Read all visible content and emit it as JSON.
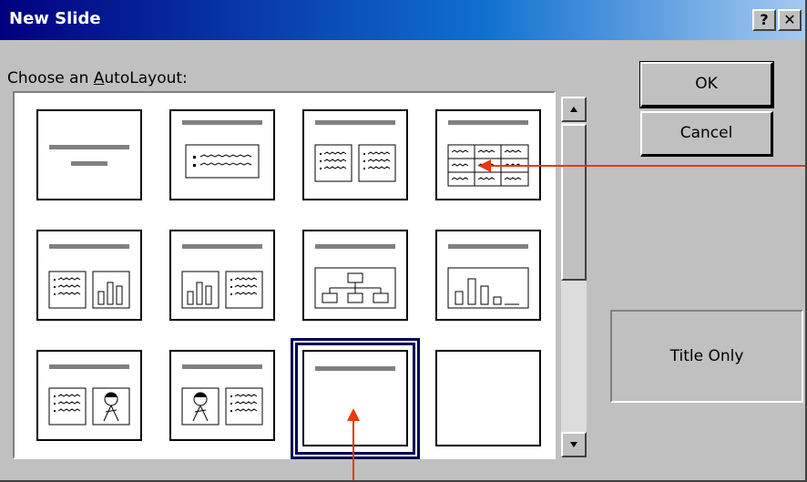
{
  "window": {
    "title": "New Slide",
    "help_label": "?",
    "close_label": "✕"
  },
  "gallery": {
    "label_prefix": "Choose an ",
    "label_accel": "A",
    "label_suffix": "utoLayout:",
    "layouts": [
      {
        "name": "Title Slide",
        "icon": "title-slide-layout"
      },
      {
        "name": "Bulleted List",
        "icon": "bulleted-list-layout"
      },
      {
        "name": "2 Column Text",
        "icon": "two-column-text-layout"
      },
      {
        "name": "Table",
        "icon": "table-layout"
      },
      {
        "name": "Text & Chart",
        "icon": "text-chart-layout"
      },
      {
        "name": "Chart & Text",
        "icon": "chart-text-layout"
      },
      {
        "name": "Organization Chart",
        "icon": "org-chart-layout"
      },
      {
        "name": "Chart",
        "icon": "chart-layout"
      },
      {
        "name": "Text & Clip Art",
        "icon": "text-clipart-layout"
      },
      {
        "name": "Clip Art & Text",
        "icon": "clipart-text-layout"
      },
      {
        "name": "Title Only",
        "icon": "title-only-layout",
        "selected": true
      },
      {
        "name": "Blank",
        "icon": "blank-layout"
      }
    ]
  },
  "buttons": {
    "ok": "OK",
    "cancel": "Cancel"
  },
  "preview": {
    "label": "Title Only"
  },
  "annotations": {
    "arrow_color": "#e8380d"
  }
}
